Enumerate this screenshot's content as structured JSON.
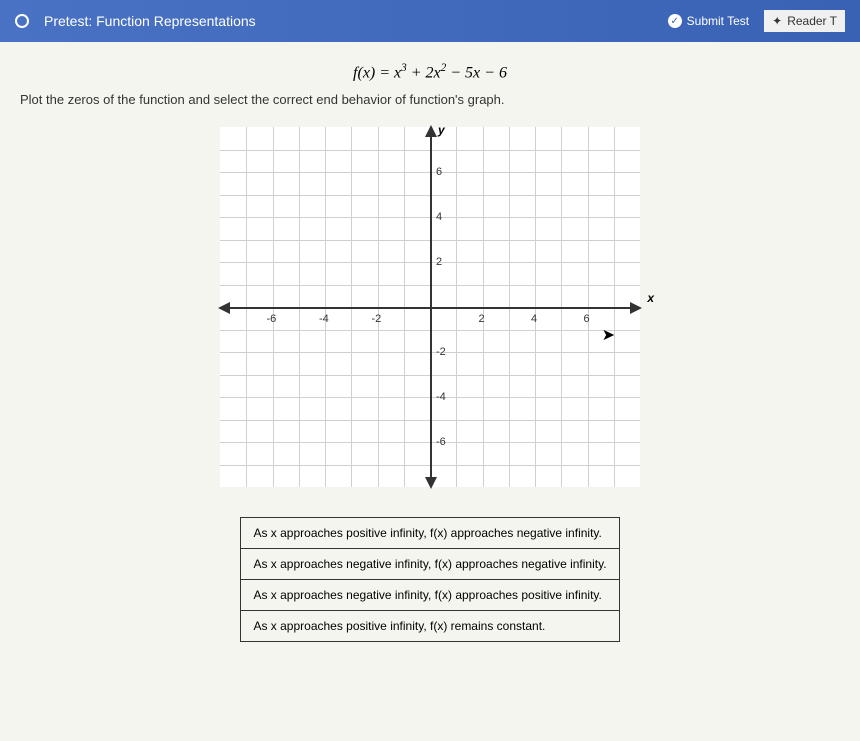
{
  "header": {
    "title": "Pretest: Function Representations",
    "submit_label": "Submit Test",
    "reader_label": "Reader T"
  },
  "formula": {
    "prefix": "f(x) = x",
    "exp1": "3",
    "mid1": " + 2x",
    "exp2": "2",
    "suffix": " − 5x − 6"
  },
  "instruction": "Plot the zeros of the function and select the correct end behavior of function's graph.",
  "chart_data": {
    "type": "scatter",
    "title": "",
    "xlabel": "x",
    "ylabel": "y",
    "xlim": [
      -8,
      8
    ],
    "ylim": [
      -8,
      8
    ],
    "xticks": [
      -6,
      -4,
      -2,
      2,
      4,
      6
    ],
    "yticks": [
      -6,
      -4,
      -2,
      2,
      4,
      6
    ],
    "grid": true,
    "series": []
  },
  "options": [
    "As x approaches positive infinity, f(x) approaches negative infinity.",
    "As x approaches negative infinity, f(x) approaches negative infinity.",
    "As x approaches negative infinity, f(x) approaches positive infinity.",
    "As x approaches positive infinity, f(x) remains constant."
  ]
}
